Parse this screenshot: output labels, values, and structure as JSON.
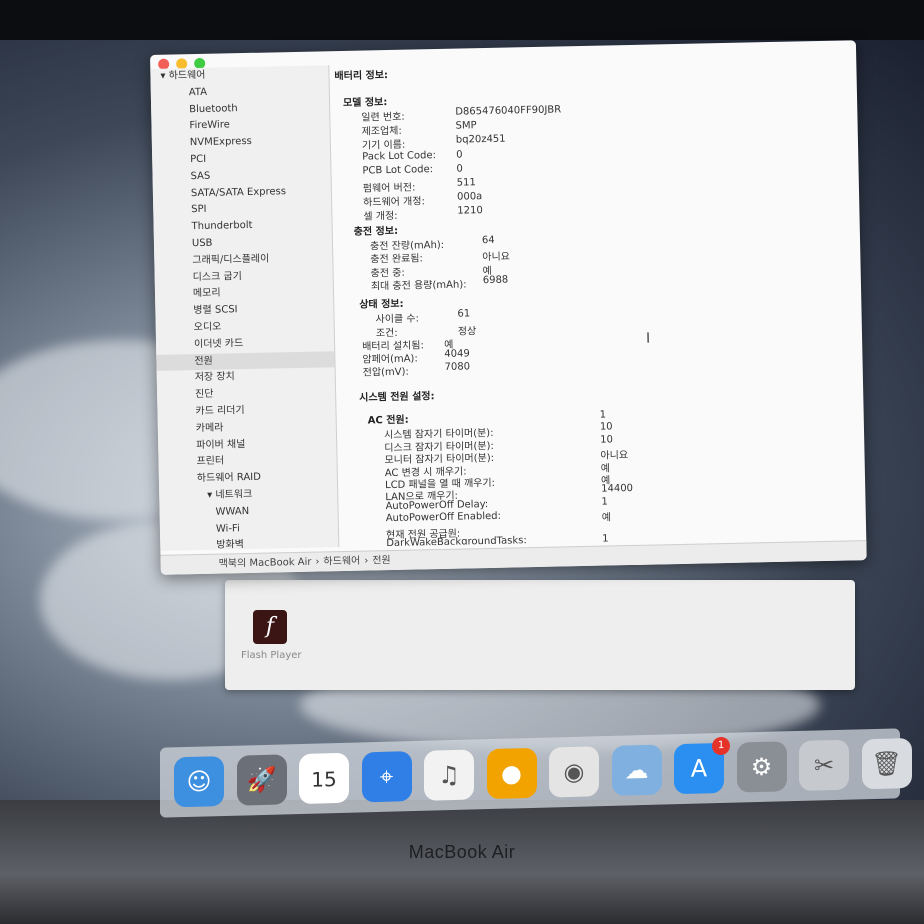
{
  "sidebar": {
    "hardware_group": "▾ 하드웨어",
    "items": [
      {
        "label": "ATA"
      },
      {
        "label": "Bluetooth"
      },
      {
        "label": "FireWire"
      },
      {
        "label": "NVMExpress"
      },
      {
        "label": "PCI"
      },
      {
        "label": "SAS"
      },
      {
        "label": "SATA/SATA Express"
      },
      {
        "label": "SPI"
      },
      {
        "label": "Thunderbolt"
      },
      {
        "label": "USB"
      },
      {
        "label": "그래픽/디스플레이"
      },
      {
        "label": "디스크 굽기"
      },
      {
        "label": "메모리"
      },
      {
        "label": "병렬 SCSI"
      },
      {
        "label": "오디오"
      },
      {
        "label": "이더넷 카드"
      },
      {
        "label": "전원",
        "selected": true
      },
      {
        "label": "저장 장치"
      },
      {
        "label": "진단"
      },
      {
        "label": "카드 리더기"
      },
      {
        "label": "카메라"
      },
      {
        "label": "파이버 채널"
      },
      {
        "label": "프린터"
      },
      {
        "label": "하드웨어 RAID"
      }
    ],
    "network_group": "▾ 네트워크",
    "network_items": [
      {
        "label": "WWAN"
      },
      {
        "label": "Wi-Fi"
      },
      {
        "label": "방화벽"
      },
      {
        "label": "볼륨"
      }
    ]
  },
  "content": {
    "battery_title": "배터리 정보:",
    "model_title": "모델 정보:",
    "model": [
      {
        "k": "일련 번호:",
        "v": "D865476040FF90JBR"
      },
      {
        "k": "제조업체:",
        "v": "SMP"
      },
      {
        "k": "기기 이름:",
        "v": "bq20z451"
      },
      {
        "k": "Pack Lot Code:",
        "v": "0"
      },
      {
        "k": "PCB Lot Code:",
        "v": "0"
      },
      {
        "k": "펌웨어 버전:",
        "v": "511"
      },
      {
        "k": "하드웨어 개정:",
        "v": "000a"
      },
      {
        "k": "셀 개정:",
        "v": "1210"
      }
    ],
    "charge_title": "충전 정보:",
    "charge": [
      {
        "k": "충전 잔량(mAh):",
        "v": "64"
      },
      {
        "k": "충전 완료됨:",
        "v": "아니요"
      },
      {
        "k": "충전 중:",
        "v": "예"
      },
      {
        "k": "최대 충전 용량(mAh):",
        "v": "6988"
      }
    ],
    "health_title": "상태 정보:",
    "health": [
      {
        "k": "사이클 수:",
        "v": "61"
      },
      {
        "k": "조건:",
        "v": "정상"
      }
    ],
    "misc": [
      {
        "k": "배터리 설치됨:",
        "v": "예"
      },
      {
        "k": "암페어(mA):",
        "v": "4049"
      },
      {
        "k": "전압(mV):",
        "v": "7080"
      }
    ],
    "power_title": "시스템 전원 설정:",
    "ac_title": "AC 전원:",
    "ac": [
      {
        "k": "",
        "v": "1"
      },
      {
        "k": "시스템 잠자기 타이머(분):",
        "v": "10"
      },
      {
        "k": "디스크 잠자기 타이머(분):",
        "v": "10"
      },
      {
        "k": "모니터 잠자기 타이머(분):",
        "v": "아니요"
      },
      {
        "k": "AC 변경 시 깨우기:",
        "v": "예"
      },
      {
        "k": "LCD 패널을 열 때 깨우기:",
        "v": "예"
      },
      {
        "k": "LAN으로 깨우기:",
        "v": "14400"
      },
      {
        "k": "AutoPowerOff Delay:",
        "v": "1"
      },
      {
        "k": "AutoPowerOff Enabled:",
        "v": "예"
      },
      {
        "k": "현재 전원 공급원:",
        "v": ""
      },
      {
        "k": "DarkWakeBackgroundTasks:",
        "v": "1"
      }
    ]
  },
  "pathbar": {
    "parts": [
      "맥북의 MacBook Air",
      "›",
      "하드웨어",
      "›",
      "전원"
    ]
  },
  "bg_window": {
    "label": "Flash Player",
    "icon_glyph": "f"
  },
  "dock": {
    "icons": [
      {
        "name": "finder-icon",
        "color": "#3d8fe0",
        "glyph": "☺"
      },
      {
        "name": "launchpad-icon",
        "color": "#6b6f78",
        "glyph": "🚀"
      },
      {
        "name": "calendar-icon",
        "color": "#ffffff",
        "glyph": "15"
      },
      {
        "name": "safari-icon",
        "color": "#2f7fe6",
        "glyph": "⌖"
      },
      {
        "name": "itunes-icon",
        "color": "#f2f2f2",
        "glyph": "♫"
      },
      {
        "name": "app-icon",
        "color": "#f2a300",
        "glyph": "●"
      },
      {
        "name": "chrome-icon",
        "color": "#e4e4e4",
        "glyph": "◉"
      },
      {
        "name": "weather-icon",
        "color": "#7fb0e0",
        "glyph": "☁"
      },
      {
        "name": "app-store-icon",
        "color": "#2a8ff0",
        "glyph": "A",
        "badge": "1"
      },
      {
        "name": "system-preferences-icon",
        "color": "#8a8e95",
        "glyph": "⚙"
      },
      {
        "name": "utility-icon",
        "color": "#c6c9ce",
        "glyph": "✂"
      },
      {
        "name": "trash-icon",
        "color": "#d8dbe0",
        "glyph": "🗑"
      }
    ]
  },
  "bezel": {
    "brand": "MacBook Air"
  }
}
